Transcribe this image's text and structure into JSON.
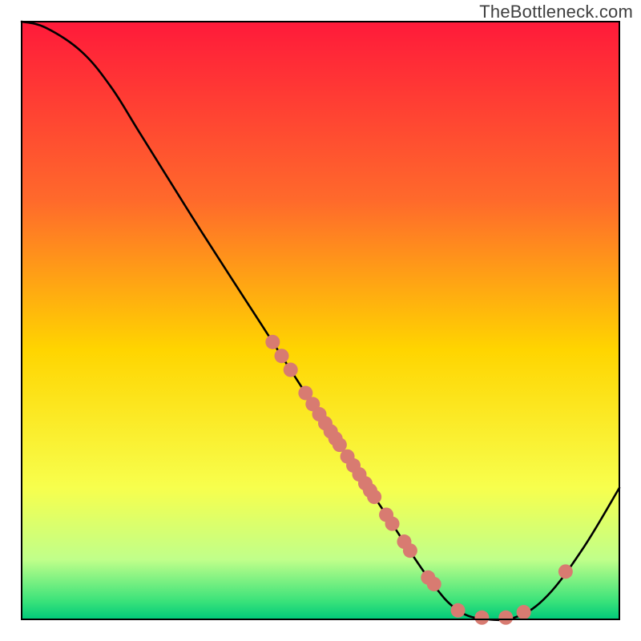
{
  "attribution": "TheBottleneck.com",
  "chart_data": {
    "type": "line",
    "title": "",
    "xlabel": "",
    "ylabel": "",
    "xlim": [
      0,
      100
    ],
    "ylim": [
      0,
      100
    ],
    "background_gradient": {
      "stops": [
        {
          "offset": 0.0,
          "color": "#ff1a3a"
        },
        {
          "offset": 0.3,
          "color": "#ff6a2b"
        },
        {
          "offset": 0.55,
          "color": "#ffd500"
        },
        {
          "offset": 0.78,
          "color": "#f7ff4d"
        },
        {
          "offset": 0.9,
          "color": "#c0ff8a"
        },
        {
          "offset": 0.97,
          "color": "#39e27a"
        },
        {
          "offset": 1.0,
          "color": "#00c97a"
        }
      ]
    },
    "curve": {
      "description": "Bottleneck severity curve. Y = 0 is optimal (green), Y = 100 is worst (red). Curve falls from top-left, reaches zero around x≈78, then rises again.",
      "points": [
        {
          "x": 0,
          "y": 100
        },
        {
          "x": 4,
          "y": 99
        },
        {
          "x": 10,
          "y": 95
        },
        {
          "x": 15,
          "y": 89
        },
        {
          "x": 20,
          "y": 81
        },
        {
          "x": 30,
          "y": 65
        },
        {
          "x": 40,
          "y": 49.5
        },
        {
          "x": 50,
          "y": 34
        },
        {
          "x": 60,
          "y": 19
        },
        {
          "x": 68,
          "y": 7
        },
        {
          "x": 73,
          "y": 1.5
        },
        {
          "x": 78,
          "y": 0
        },
        {
          "x": 83,
          "y": 0.5
        },
        {
          "x": 88,
          "y": 4
        },
        {
          "x": 94,
          "y": 12
        },
        {
          "x": 100,
          "y": 22
        }
      ]
    },
    "markers": {
      "description": "Highlighted data points (salmon dots) lying on the curve.",
      "color": "#d87b71",
      "radius": 9,
      "x_values": [
        42,
        43.5,
        45,
        47.5,
        48.7,
        49.8,
        50.8,
        51.7,
        52.5,
        53.2,
        54.5,
        55.5,
        56.5,
        57.5,
        58.3,
        59,
        61,
        62,
        64,
        65,
        68,
        69,
        73,
        77,
        81,
        84,
        91
      ]
    }
  }
}
